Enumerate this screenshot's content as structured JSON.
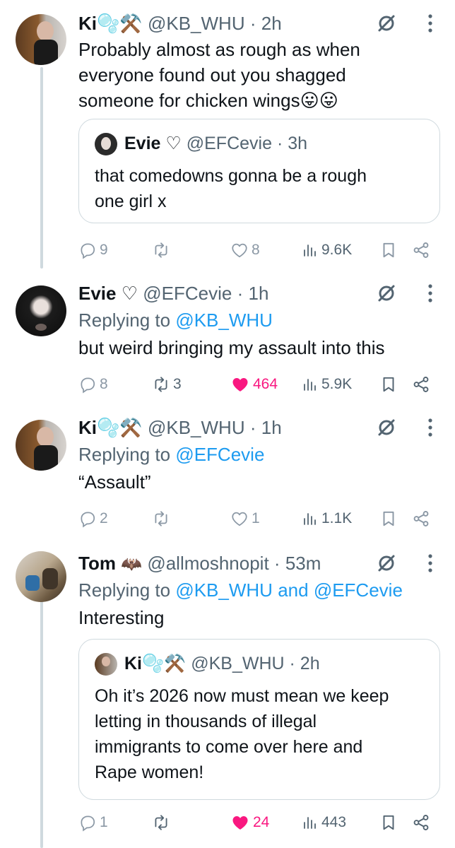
{
  "tweets": [
    {
      "name": "Ki🫧⚒️",
      "handle": "@KB_WHU",
      "time": "2h",
      "text_lines": [
        "Probably almost as rough as when",
        "everyone found out you shagged",
        "someone for chicken wings😛😛"
      ],
      "quote": {
        "name": "Evie ♡",
        "handle": "@EFCevie",
        "time": "3h",
        "text_lines": [
          "that comedowns gonna be a rough",
          "one girl x"
        ]
      },
      "replies": "9",
      "reposts": "",
      "likes": "8",
      "views": "9.6K"
    },
    {
      "name": "Evie ♡",
      "handle": "@EFCevie",
      "time": "1h",
      "replying_prefix": "Replying to",
      "replying_to": "@KB_WHU",
      "text_lines": [
        "but weird bringing my assault into this"
      ],
      "replies": "8",
      "reposts": "3",
      "likes": "464",
      "views": "5.9K"
    },
    {
      "name": "Ki🫧⚒️",
      "handle": "@KB_WHU",
      "time": "1h",
      "replying_prefix": "Replying to",
      "replying_to": "@EFCevie",
      "text_lines": [
        "“Assault”"
      ],
      "replies": "2",
      "reposts": "",
      "likes": "1",
      "views": "1.1K"
    },
    {
      "name": "Tom",
      "name_emoji": "🦇",
      "handle": "@allmoshnopit",
      "time": "53m",
      "replying_prefix": "Replying to",
      "replying_to_1": "@KB_WHU",
      "replying_and": "and",
      "replying_to_2": "@EFCevie",
      "text_lines": [
        "Interesting"
      ],
      "quote": {
        "name": "Ki🫧⚒️",
        "handle": "@KB_WHU",
        "time": "2h",
        "text_lines": [
          "Oh it’s 2026 now must mean we keep",
          "letting in thousands of illegal",
          "immigrants to come over here and",
          "Rape women!"
        ]
      },
      "replies": "1",
      "reposts": "",
      "likes": "24",
      "views": "443"
    }
  ],
  "separator": "·",
  "colors": {
    "text": "#0f1419",
    "secondary": "#536471",
    "link": "#1d9bf0",
    "like": "#f91880",
    "border": "#cfd9de"
  },
  "icons": [
    "reply-icon",
    "repost-icon",
    "like-icon",
    "views-icon",
    "bookmark-icon",
    "share-icon",
    "grok-icon",
    "more-icon"
  ]
}
